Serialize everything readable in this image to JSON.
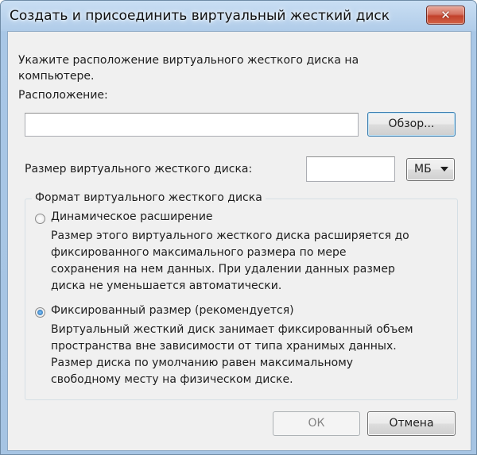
{
  "window": {
    "title": "Создать и присоединить виртуальный жесткий диск"
  },
  "location": {
    "instruction": "Укажите расположение виртуального жесткого диска на компьютере.",
    "label": "Расположение:",
    "value": "",
    "browse_label": "Обзор..."
  },
  "size": {
    "label": "Размер виртуального жесткого диска:",
    "value": "",
    "unit": "МБ"
  },
  "format": {
    "legend": "Формат виртуального жесткого диска",
    "options": [
      {
        "label": "Динамическое расширение",
        "checked": false,
        "description_lines": [
          "Размер этого виртуального жесткого диска расширяется до",
          "фиксированного максимального размера по мере",
          "сохранения на нем данных. При удалении данных размер",
          "диска не уменьшается автоматически."
        ]
      },
      {
        "label": "Фиксированный размер (рекомендуется)",
        "checked": true,
        "description_lines": [
          "Виртуальный жесткий диск занимает фиксированный объем",
          "пространства вне зависимости от типа хранимых данных.",
          "Размер диска по умолчанию равен максимальному",
          "свободному месту на физическом диске."
        ]
      }
    ]
  },
  "buttons": {
    "ok_label": "ОК",
    "cancel_label": "Отмена"
  },
  "icons": {
    "close": "close-icon",
    "dropdown": "chevron-down-icon",
    "radio_selected": "radio-selected",
    "radio_unselected": "radio-unselected"
  }
}
